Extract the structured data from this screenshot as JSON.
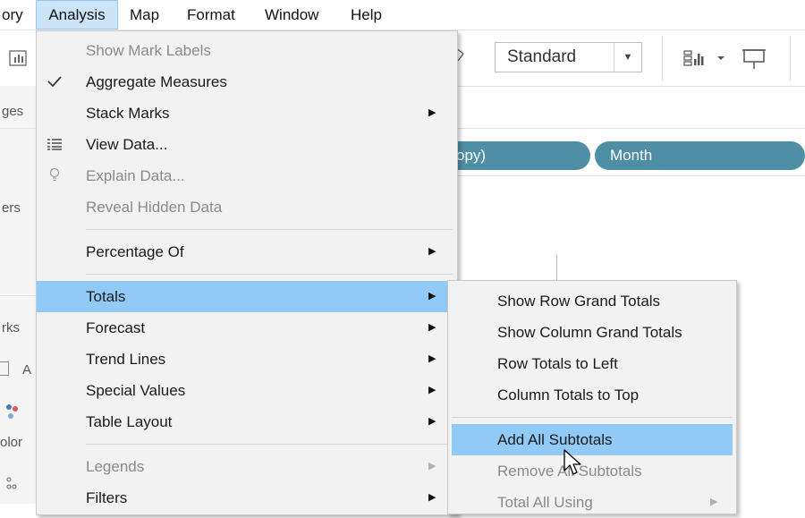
{
  "menubar": {
    "items": [
      {
        "label": "ory"
      },
      {
        "label": "Analysis"
      },
      {
        "label": "Map"
      },
      {
        "label": "Format"
      },
      {
        "label": "Window"
      },
      {
        "label": "Help"
      }
    ]
  },
  "toolbar": {
    "mark_type_value": "Standard"
  },
  "left_pane": {
    "labels": [
      "ges",
      "ers",
      "rks",
      "A",
      "olor"
    ]
  },
  "shelf": {
    "pills": [
      "opy)",
      "Month"
    ]
  },
  "analysis_menu": {
    "items": [
      {
        "label": "Show Mark Labels"
      },
      {
        "label": "Aggregate Measures"
      },
      {
        "label": "Stack Marks"
      },
      {
        "label": "View Data..."
      },
      {
        "label": "Explain Data..."
      },
      {
        "label": "Reveal Hidden Data"
      },
      {
        "label": "Percentage Of"
      },
      {
        "label": "Totals"
      },
      {
        "label": "Forecast"
      },
      {
        "label": "Trend Lines"
      },
      {
        "label": "Special Values"
      },
      {
        "label": "Table Layout"
      },
      {
        "label": "Legends"
      },
      {
        "label": "Filters"
      }
    ]
  },
  "totals_submenu": {
    "items": [
      {
        "label": "Show Row Grand Totals"
      },
      {
        "label": "Show Column Grand Totals"
      },
      {
        "label": "Row Totals to Left"
      },
      {
        "label": "Column Totals to Top"
      },
      {
        "label": "Add All Subtotals"
      },
      {
        "label": "Remove All Subtotals"
      },
      {
        "label": "Total All Using"
      }
    ]
  },
  "colors": {
    "highlight": "#91c9f7",
    "pill": "#4f8fa6",
    "menu_bg": "#f2f2f2",
    "menubar_active": "#cce4f7"
  }
}
